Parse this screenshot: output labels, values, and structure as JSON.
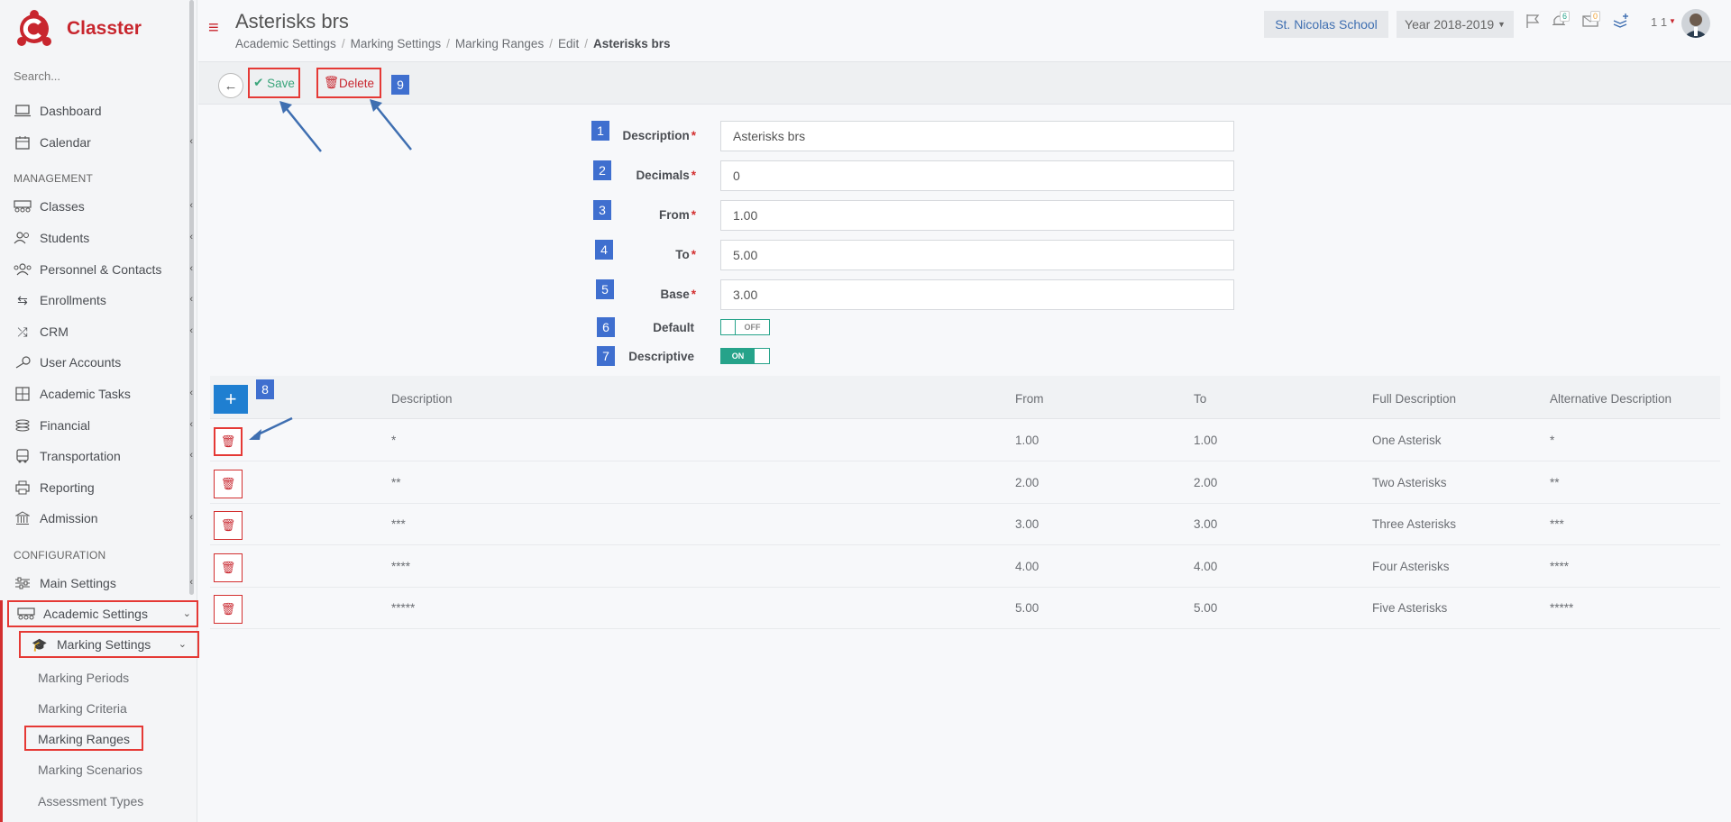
{
  "app": {
    "brand": "Classter"
  },
  "sidebar": {
    "search_placeholder": "Search...",
    "items": [
      {
        "label": "Dashboard",
        "icon": "laptop-icon"
      },
      {
        "label": "Calendar",
        "icon": "calendar-icon"
      },
      {
        "label": "Classes",
        "icon": "classes-icon"
      },
      {
        "label": "Students",
        "icon": "users-icon"
      },
      {
        "label": "Personnel & Contacts",
        "icon": "group-icon"
      },
      {
        "label": "Enrollments",
        "icon": "exchange-icon"
      },
      {
        "label": "CRM",
        "icon": "shuffle-icon"
      },
      {
        "label": "User Accounts",
        "icon": "key-icon"
      },
      {
        "label": "Academic Tasks",
        "icon": "grid-icon"
      },
      {
        "label": "Financial",
        "icon": "coins-icon"
      },
      {
        "label": "Transportation",
        "icon": "bus-icon"
      },
      {
        "label": "Reporting",
        "icon": "print-icon"
      },
      {
        "label": "Admission",
        "icon": "bank-icon"
      },
      {
        "label": "Main Settings",
        "icon": "sliders-icon"
      },
      {
        "label": "Academic Settings",
        "icon": "classes-icon"
      }
    ],
    "sections": {
      "management": "MANAGEMENT",
      "configuration": "CONFIGURATION"
    },
    "marking_settings": "Marking Settings",
    "sub_items": [
      "Marking Periods",
      "Marking Criteria",
      "Marking Ranges",
      "Marking Scenarios",
      "Assessment Types"
    ]
  },
  "header": {
    "title": "Asterisks brs",
    "breadcrumb": [
      "Academic Settings",
      "Marking Settings",
      "Marking Ranges",
      "Edit",
      "Asterisks brs"
    ],
    "school": "St. Nicolas School",
    "year": "Year 2018-2019",
    "notifications_count": "6",
    "messages_count": "0",
    "user_number": "1 1"
  },
  "toolbar": {
    "save_label": "Save",
    "delete_label": "Delete"
  },
  "annotations": [
    "1",
    "2",
    "3",
    "4",
    "5",
    "6",
    "7",
    "8",
    "9"
  ],
  "form": {
    "description_label": "Description",
    "description_value": "Asterisks brs",
    "decimals_label": "Decimals",
    "decimals_value": "0",
    "from_label": "From",
    "from_value": "1.00",
    "to_label": "To",
    "to_value": "5.00",
    "base_label": "Base",
    "base_value": "3.00",
    "default_label": "Default",
    "default_state": "OFF",
    "descriptive_label": "Descriptive",
    "descriptive_state": "ON",
    "required_mark": "*"
  },
  "table": {
    "headers": [
      "Description",
      "From",
      "To",
      "Full Description",
      "Alternative Description"
    ],
    "rows": [
      [
        "*",
        "1.00",
        "1.00",
        "One Asterisk",
        "*"
      ],
      [
        "**",
        "2.00",
        "2.00",
        "Two Asterisks",
        "**"
      ],
      [
        "***",
        "3.00",
        "3.00",
        "Three Asterisks",
        "***"
      ],
      [
        "****",
        "4.00",
        "4.00",
        "Four Asterisks",
        "****"
      ],
      [
        "*****",
        "5.00",
        "5.00",
        "Five Asterisks",
        "*****"
      ]
    ]
  },
  "colors": {
    "brand_red": "#c8262e",
    "accent_blue": "#1f7fd1",
    "toggle_green": "#26a38a",
    "annotation_blue": "#3f6fcf",
    "highlight_red": "#e53935"
  }
}
